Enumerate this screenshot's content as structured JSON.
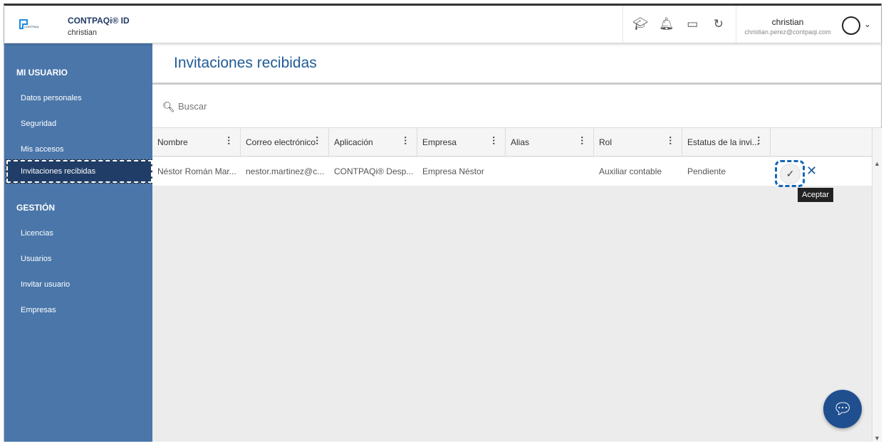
{
  "header": {
    "app_name": "CONTPAQi® ID",
    "app_user": "christian",
    "user_name": "christian",
    "user_email": "christian.perez@contpaqi.com",
    "icons": [
      "graduation-cap-icon",
      "bell-icon",
      "window-icon",
      "refresh-icon"
    ]
  },
  "sidebar": {
    "section1": "MI USUARIO",
    "items1": [
      "Datos personales",
      "Seguridad",
      "Mis accesos",
      "Invitaciones recibidas"
    ],
    "section2": "GESTIÓN",
    "items2": [
      "Licencias",
      "Usuarios",
      "Invitar usuario",
      "Empresas"
    ]
  },
  "page": {
    "title": "Invitaciones recibidas",
    "search_placeholder": "Buscar"
  },
  "table": {
    "columns": [
      "Nombre",
      "Correo electrónico",
      "Aplicación",
      "Empresa",
      "Alias",
      "Rol",
      "Estatus de la invi..."
    ],
    "rows": [
      [
        "Néstor Román Mar...",
        "nestor.martinez@c...",
        "CONTPAQi® Desp...",
        "Empresa Néstor",
        "",
        "Auxiliar contable",
        "Pendiente"
      ]
    ]
  },
  "tooltip": "Aceptar"
}
